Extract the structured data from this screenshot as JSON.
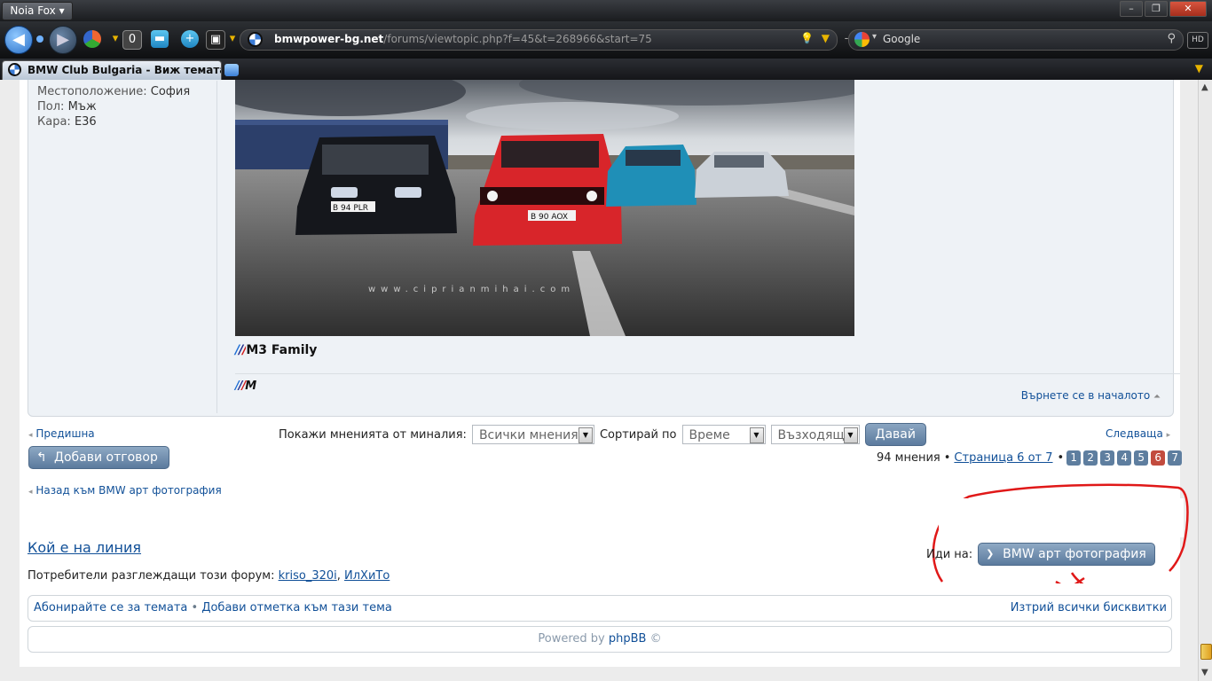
{
  "browser": {
    "menu_label": "Noia Fox",
    "address": {
      "domain": "bmwpower-bg.net",
      "path": "/forums/viewtopic.php?f=45&t=268966&start=75"
    },
    "search": {
      "engine": "Google"
    },
    "hd_label": "HD",
    "tab": {
      "title": "BMW Club Bulgaria - Виж темата - Т..."
    }
  },
  "post": {
    "profile": [
      {
        "key": "Местоположение:",
        "value": "София"
      },
      {
        "key": "Пол:",
        "value": "Мъж"
      },
      {
        "key": "Кара:",
        "value": "Е36"
      }
    ],
    "photo": {
      "plate_left": "B 94 PLR",
      "plate_center": "B 90 AOX",
      "watermark": "www.ciprianmihai.com"
    },
    "signature_title": "M3 Family",
    "signature_m": "M",
    "back_to_top": "Върнете се в началото"
  },
  "topic_nav": {
    "prev": "Предишна",
    "next": "Следваща",
    "show_label": "Покажи мненията от миналия:",
    "show_value": "Всички мнения",
    "sort_label": "Сортирай по",
    "sort_value": "Време",
    "order_value": "Възходящ",
    "go_button": "Давай"
  },
  "reply_button": "Добави отговор",
  "pagination": {
    "count_text": "94 мнения",
    "page_text": "Страница 6 от 7",
    "pages": [
      "1",
      "2",
      "3",
      "4",
      "5",
      "6",
      "7"
    ],
    "current": "6"
  },
  "back_to_forum": "Назад към BMW арт фотография",
  "online": {
    "title": "Кой е на линия",
    "users_label": "Потребители разглеждащи този форум:",
    "users": [
      "kriso_320i",
      "ИлХиТо"
    ]
  },
  "jump": {
    "label": "Иди на:",
    "button": "BMW арт фотография"
  },
  "footer": {
    "subscribe": "Абонирайте се за темата",
    "bookmark": "Добави отметка към тази тема",
    "delete_cookies": "Изтрий всички бисквитки"
  },
  "copyright": {
    "powered": "Powered by",
    "brand": "phpBB",
    "symbol": "©"
  },
  "colors": {
    "link": "#115098",
    "button": "#5b7a9d",
    "annotation": "#e01818",
    "current_page": "#c24b3e"
  }
}
